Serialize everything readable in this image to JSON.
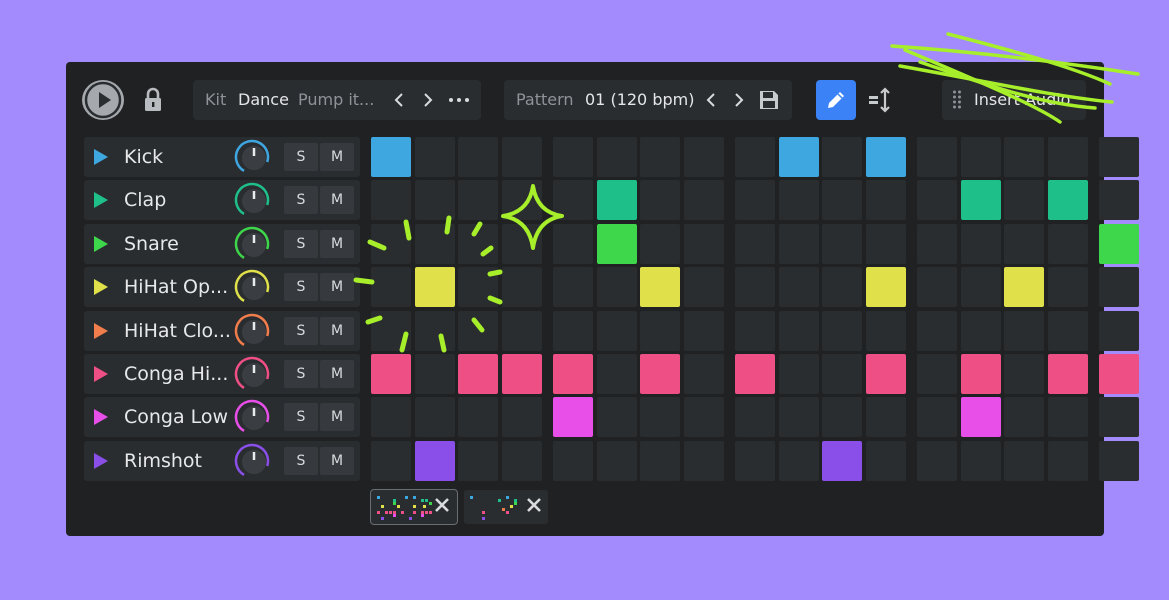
{
  "toolbar": {
    "kit_label": "Kit",
    "kit_value": "Dance",
    "kit_preset": "Pump it...",
    "pattern_label": "Pattern",
    "pattern_value": "01 (120 bpm)",
    "insert_label": "Insert Audio"
  },
  "tracks": [
    {
      "name": "Kick",
      "color": "#3fa7e0"
    },
    {
      "name": "Clap",
      "color": "#1fbf8a"
    },
    {
      "name": "Snare",
      "color": "#3ed64b"
    },
    {
      "name": "HiHat Op...",
      "color": "#dfe04a"
    },
    {
      "name": "HiHat Clo...",
      "color": "#f07d4b"
    },
    {
      "name": "Conga Hi...",
      "color": "#ee4f84"
    },
    {
      "name": "Conga Low",
      "color": "#e84ee8"
    },
    {
      "name": "Rimshot",
      "color": "#8a4fe8"
    }
  ],
  "solo_label": "S",
  "mute_label": "M",
  "steps": [
    [
      0,
      9,
      11
    ],
    [
      5,
      13,
      15
    ],
    [
      5,
      16
    ],
    [
      1,
      6,
      11,
      14
    ],
    [],
    [
      0,
      2,
      3,
      4,
      6,
      8,
      11,
      13,
      15,
      16
    ],
    [
      4,
      13
    ],
    [
      1,
      10
    ]
  ],
  "colors": {
    "background": "#a38bfe",
    "panel": "#1f2123",
    "accent": "#3b82f6",
    "scribble": "#a6ef2a"
  },
  "icons": [
    "play-icon",
    "lock-icon",
    "chevron-left-icon",
    "chevron-right-icon",
    "more-icon",
    "save-icon",
    "pencil-icon",
    "sort-arrows-icon",
    "drag-handle-icon",
    "close-icon"
  ]
}
